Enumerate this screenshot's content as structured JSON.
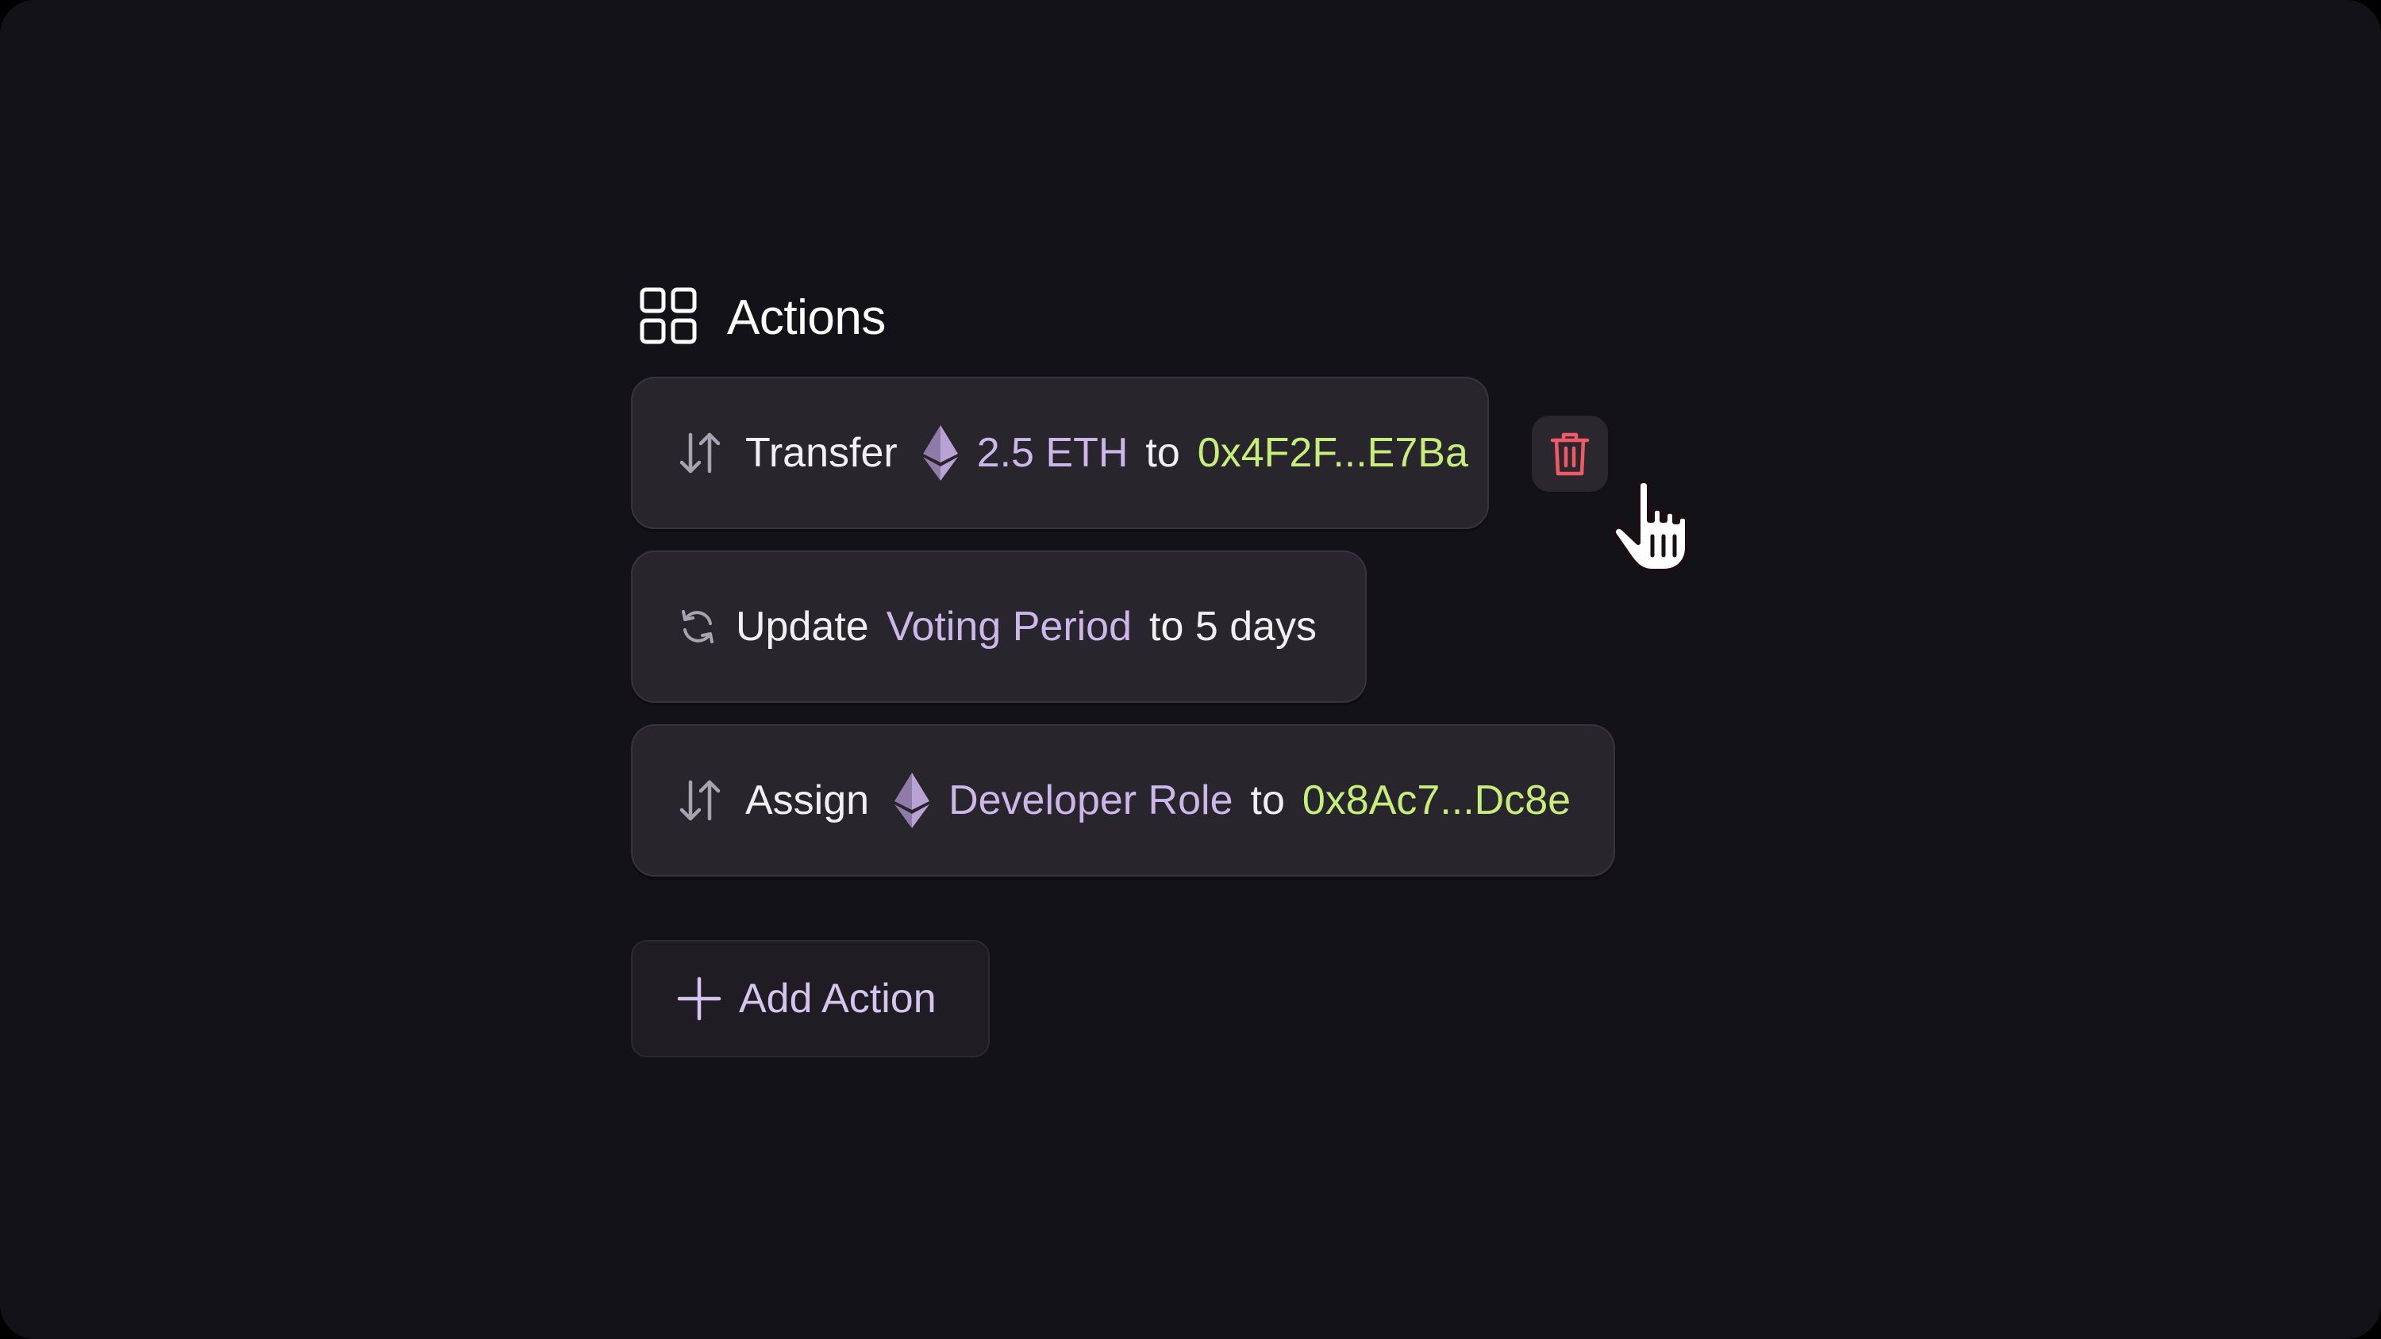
{
  "header": {
    "title": "Actions",
    "icon": "grid-icon"
  },
  "actions": [
    {
      "icon": "transfer-arrows-icon",
      "verb": "Transfer",
      "token_icon": "ethereum-icon",
      "subject": "2.5 ETH",
      "connector": "to",
      "target": "0x4F2F...E7Ba"
    },
    {
      "icon": "refresh-icon",
      "verb": "Update",
      "subject": "Voting Period",
      "connector": "to 5 days"
    },
    {
      "icon": "transfer-arrows-icon",
      "verb": "Assign",
      "token_icon": "ethereum-icon",
      "subject": "Developer Role",
      "connector": "to",
      "target": "0x8Ac7...Dc8e"
    }
  ],
  "delete_button": {
    "icon": "trash-icon"
  },
  "add_action": {
    "label": "Add Action",
    "icon": "plus-icon"
  },
  "colors": {
    "background": "#141219",
    "card": "#28252c",
    "accent_purple": "#cdb7ea",
    "accent_green": "#c6ee7a",
    "danger": "#ef5a64"
  }
}
